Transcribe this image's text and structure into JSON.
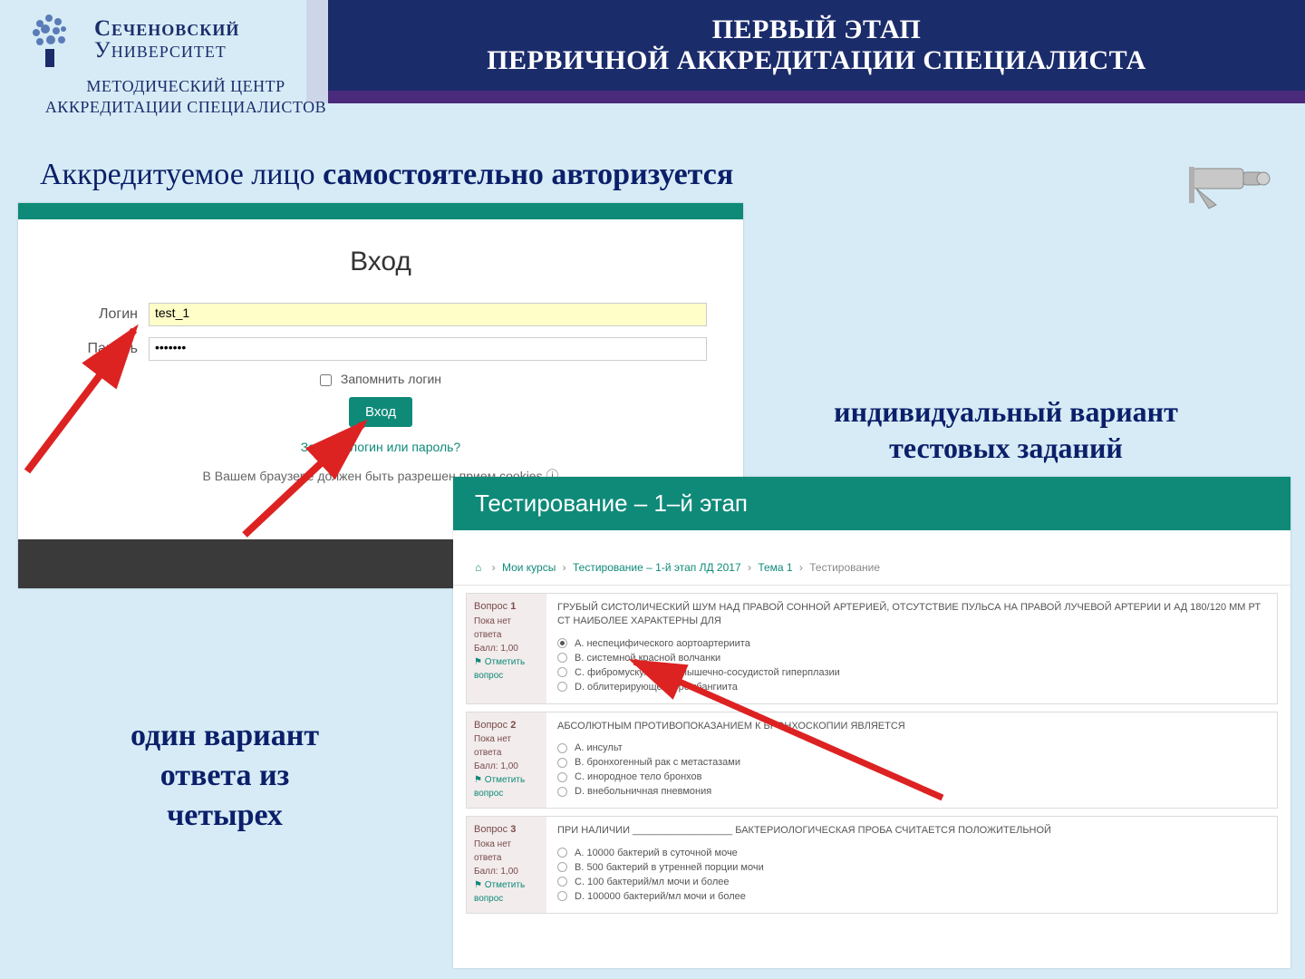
{
  "logo": {
    "line1": "Сеченовский",
    "line2": "Университет",
    "sub1": "МЕТОДИЧЕСКИЙ ЦЕНТР",
    "sub2": "АККРЕДИТАЦИИ СПЕЦИАЛИСТОВ"
  },
  "title": {
    "line1": "ПЕРВЫЙ ЭТАП",
    "line2": "ПЕРВИЧНОЙ АККРЕДИТАЦИИ СПЕЦИАЛИСТА"
  },
  "subtitle": {
    "part1": "Аккредитуемое лицо ",
    "part2": "самостоятельно авторизуется"
  },
  "login": {
    "heading": "Вход",
    "login_label": "Логин",
    "login_value": "test_1",
    "password_label": "Пароль",
    "password_value": "•••••••",
    "remember": "Запомнить логин",
    "button": "Вход",
    "forgot": "Забыли логин или пароль?",
    "cookies": "В Вашем браузере должен быть разрешен прием cookies ⓘ"
  },
  "callout_right": {
    "line1": "индивидуальный вариант",
    "line2": "тестовых заданий"
  },
  "callout_left": {
    "line1": "один вариант",
    "line2": "ответа из",
    "line3": "четырех"
  },
  "test": {
    "header_bold": "Тестирование – 1–",
    "header_rest": "й этап",
    "breadcrumb": {
      "home": "⌂",
      "b1": "Мои курсы",
      "b2": "Тестирование – 1-й этап ЛД 2017",
      "b3": "Тема 1",
      "b4": "Тестирование"
    },
    "side": {
      "q_label": "Вопрос",
      "no_answer": "Пока нет ответа",
      "score": "Балл: 1,00",
      "mark": "⚑ Отметить вопрос"
    },
    "questions": [
      {
        "num": "1",
        "text": "ГРУБЫЙ СИСТОЛИЧЕСКИЙ ШУМ НАД ПРАВОЙ СОННОЙ АРТЕРИЕЙ, ОТСУТСТВИЕ ПУЛЬСА НА ПРАВОЙ ЛУЧЕВОЙ АРТЕРИИ И АД 180/120 ММ РТ СТ НАИБОЛЕЕ ХАРАКТЕРНЫ ДЛЯ",
        "opts": [
          "A. неспецифического аортоартериита",
          "B. системной красной волчанки",
          "C. фибромускулярной мышечно-сосудистой гиперплазии",
          "D. облитерирующего тромбангиита"
        ],
        "selected": 0
      },
      {
        "num": "2",
        "text": "АБСОЛЮТНЫМ ПРОТИВОПОКАЗАНИЕМ К БРОНХОСКОПИИ ЯВЛЯЕТСЯ",
        "opts": [
          "A. инсульт",
          "B. бронхогенный рак с метастазами",
          "C. инородное тело бронхов",
          "D. внебольничная пневмония"
        ],
        "selected": -1
      },
      {
        "num": "3",
        "text": "ПРИ НАЛИЧИИ __________________ БАКТЕРИОЛОГИЧЕСКАЯ ПРОБА СЧИТАЕТСЯ ПОЛОЖИТЕЛЬНОЙ",
        "opts": [
          "A. 10000 бактерий в суточной моче",
          "B. 500 бактерий в утренней порции мочи",
          "C. 100 бактерий/мл мочи и более",
          "D. 100000 бактерий/мл мочи и более"
        ],
        "selected": -1
      }
    ]
  }
}
